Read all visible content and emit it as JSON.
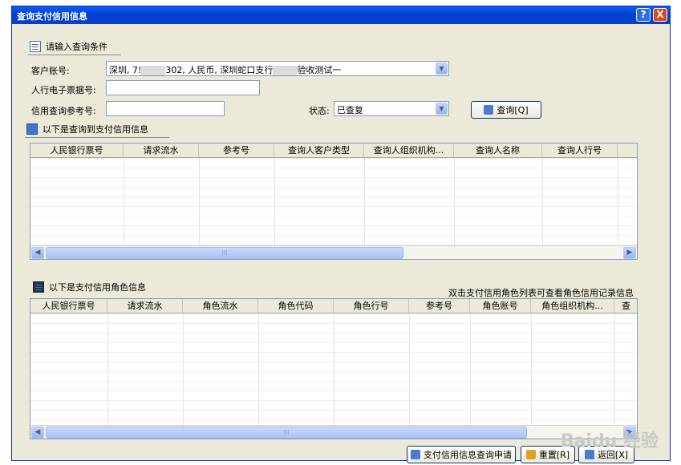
{
  "window": {
    "title": "查询支付信用信息",
    "help_button": "?",
    "close_button": "X"
  },
  "query_section": {
    "title": "请输入查询条件",
    "customer_account_label": "客户账号:",
    "customer_account_value_pre": "深圳, 7!",
    "customer_account_value_mid": "302, 人民币, 深圳蛇口支行",
    "customer_account_value_post": "验收测试一",
    "bank_note_label": "人行电子票据号:",
    "bank_note_value": "",
    "credit_ref_label": "信用查询参考号:",
    "credit_ref_value": "",
    "status_label": "状态:",
    "status_value": "已查复",
    "query_button": "查询[Q]"
  },
  "payment_credit_section": {
    "title": "以下是查询到支付信用信息",
    "columns": [
      "人民银行票号",
      "请求流水",
      "参考号",
      "查询人客户类型",
      "查询人组织机构...",
      "查询人名称",
      "查询人行号"
    ],
    "scroll_thumb": "III"
  },
  "role_section": {
    "title": "以下是支付信用角色信息",
    "hint": "双击支付信用角色列表可查看角色信用记录信息",
    "columns": [
      "人民银行票号",
      "请求流水",
      "角色流水",
      "角色代码",
      "角色行号",
      "参考号",
      "角色账号",
      "角色组织机构...",
      "查"
    ],
    "scroll_thumb": "III"
  },
  "bottom_buttons": {
    "apply": "支付信用信息查询申请",
    "reset": "重置[R]",
    "return": "返回[X]"
  },
  "watermark": "Baidu 经验"
}
